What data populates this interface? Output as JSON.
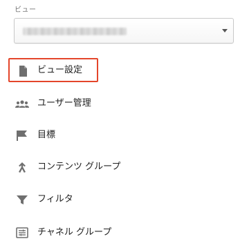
{
  "panel": {
    "view_label": "ビュー",
    "view_select": {
      "value_redacted": true
    },
    "items": [
      {
        "label": "ビュー設定",
        "icon": "document-icon",
        "selected": true
      },
      {
        "label": "ユーザー管理",
        "icon": "users-icon",
        "selected": false
      },
      {
        "label": "目標",
        "icon": "flag-icon",
        "selected": false
      },
      {
        "label": "コンテンツ グループ",
        "icon": "content-grouping-icon",
        "selected": false
      },
      {
        "label": "フィルタ",
        "icon": "filter-icon",
        "selected": false
      },
      {
        "label": "チャネル グループ",
        "icon": "channel-grouping-icon",
        "selected": false
      }
    ]
  },
  "colors": {
    "highlight_border": "#e4452a",
    "icon": "#6f6f6f",
    "text": "#212121"
  }
}
